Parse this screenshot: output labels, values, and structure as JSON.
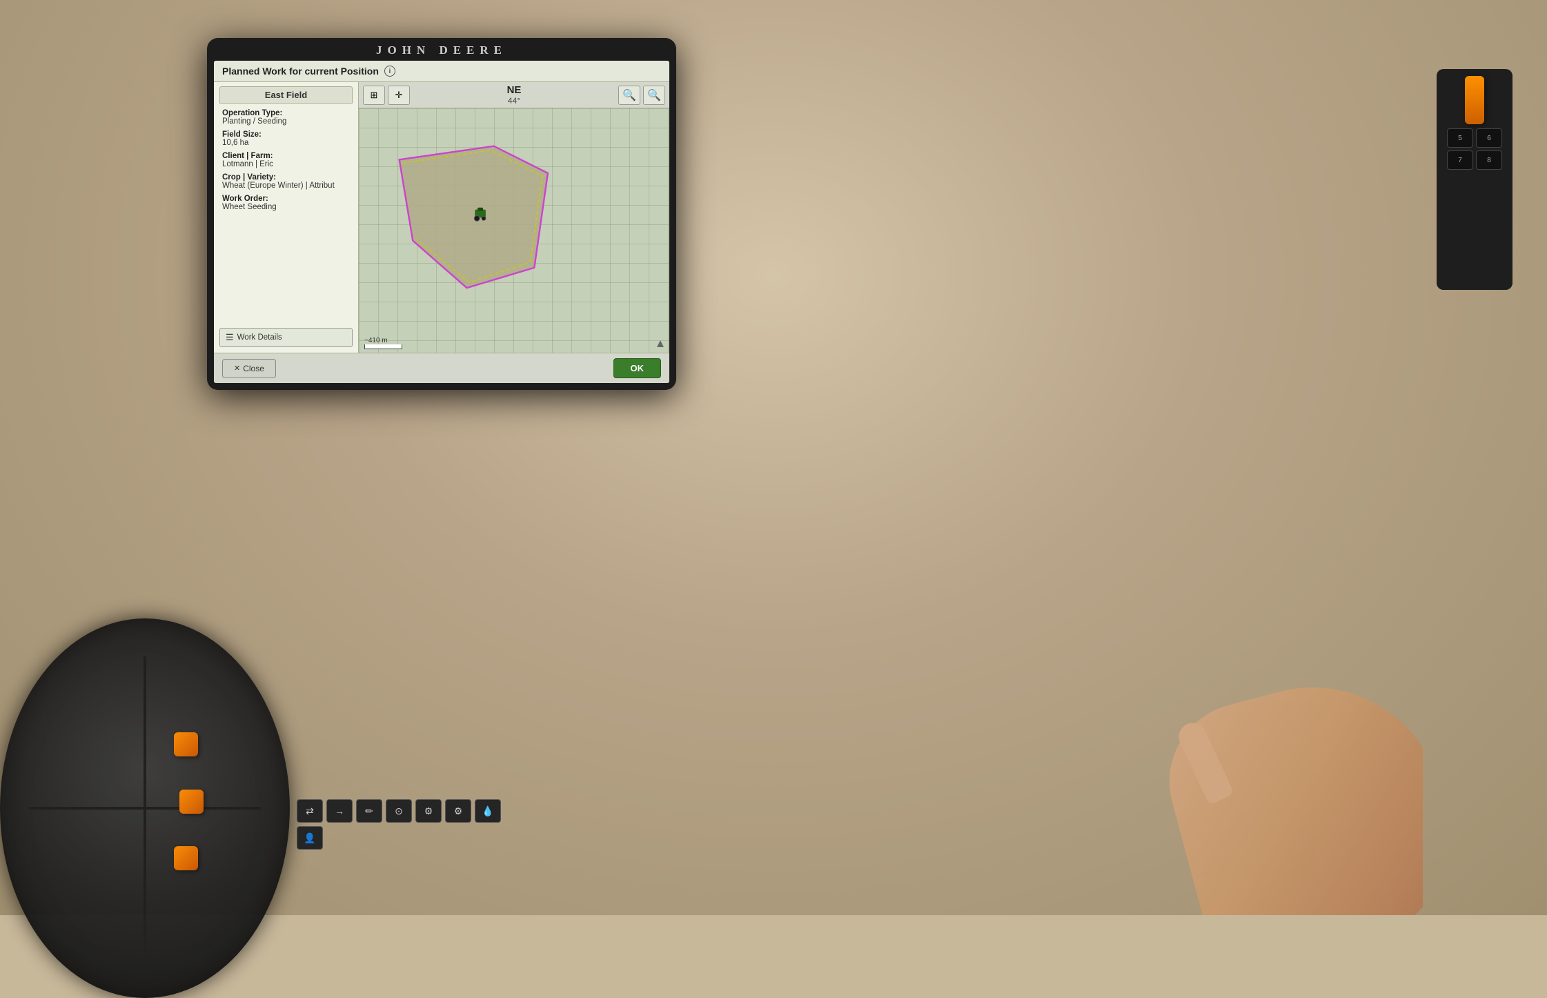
{
  "brand": "John Deere",
  "dialog": {
    "title": "Planned Work for current Position",
    "info_icon": "i",
    "field_tab": "East Field",
    "field_info": {
      "operation_type_label": "Operation Type:",
      "operation_type_value": "Planting / Seeding",
      "field_size_label": "Field Size:",
      "field_size_value": "10,6 ha",
      "client_farm_label": "Client | Farm:",
      "client_farm_value": "Lotmann | Eric",
      "crop_variety_label": "Crop | Variety:",
      "crop_variety_value": "Wheat (Europe Winter) | Attribut",
      "work_order_label": "Work Order:",
      "work_order_value": "Wheet Seeding"
    },
    "work_details_btn": "Work Details",
    "map": {
      "compass_dir": "NE",
      "compass_deg": "44°",
      "scale_label": "~410 m"
    },
    "footer": {
      "close_btn": "Close",
      "ok_btn": "OK"
    }
  },
  "colors": {
    "ok_btn_bg": "#3a7d2a",
    "field_outline": "#cc44cc",
    "field_fill": "#b8b090",
    "dashed_line": "#cccc00",
    "tractor": "#2a6a1a"
  }
}
